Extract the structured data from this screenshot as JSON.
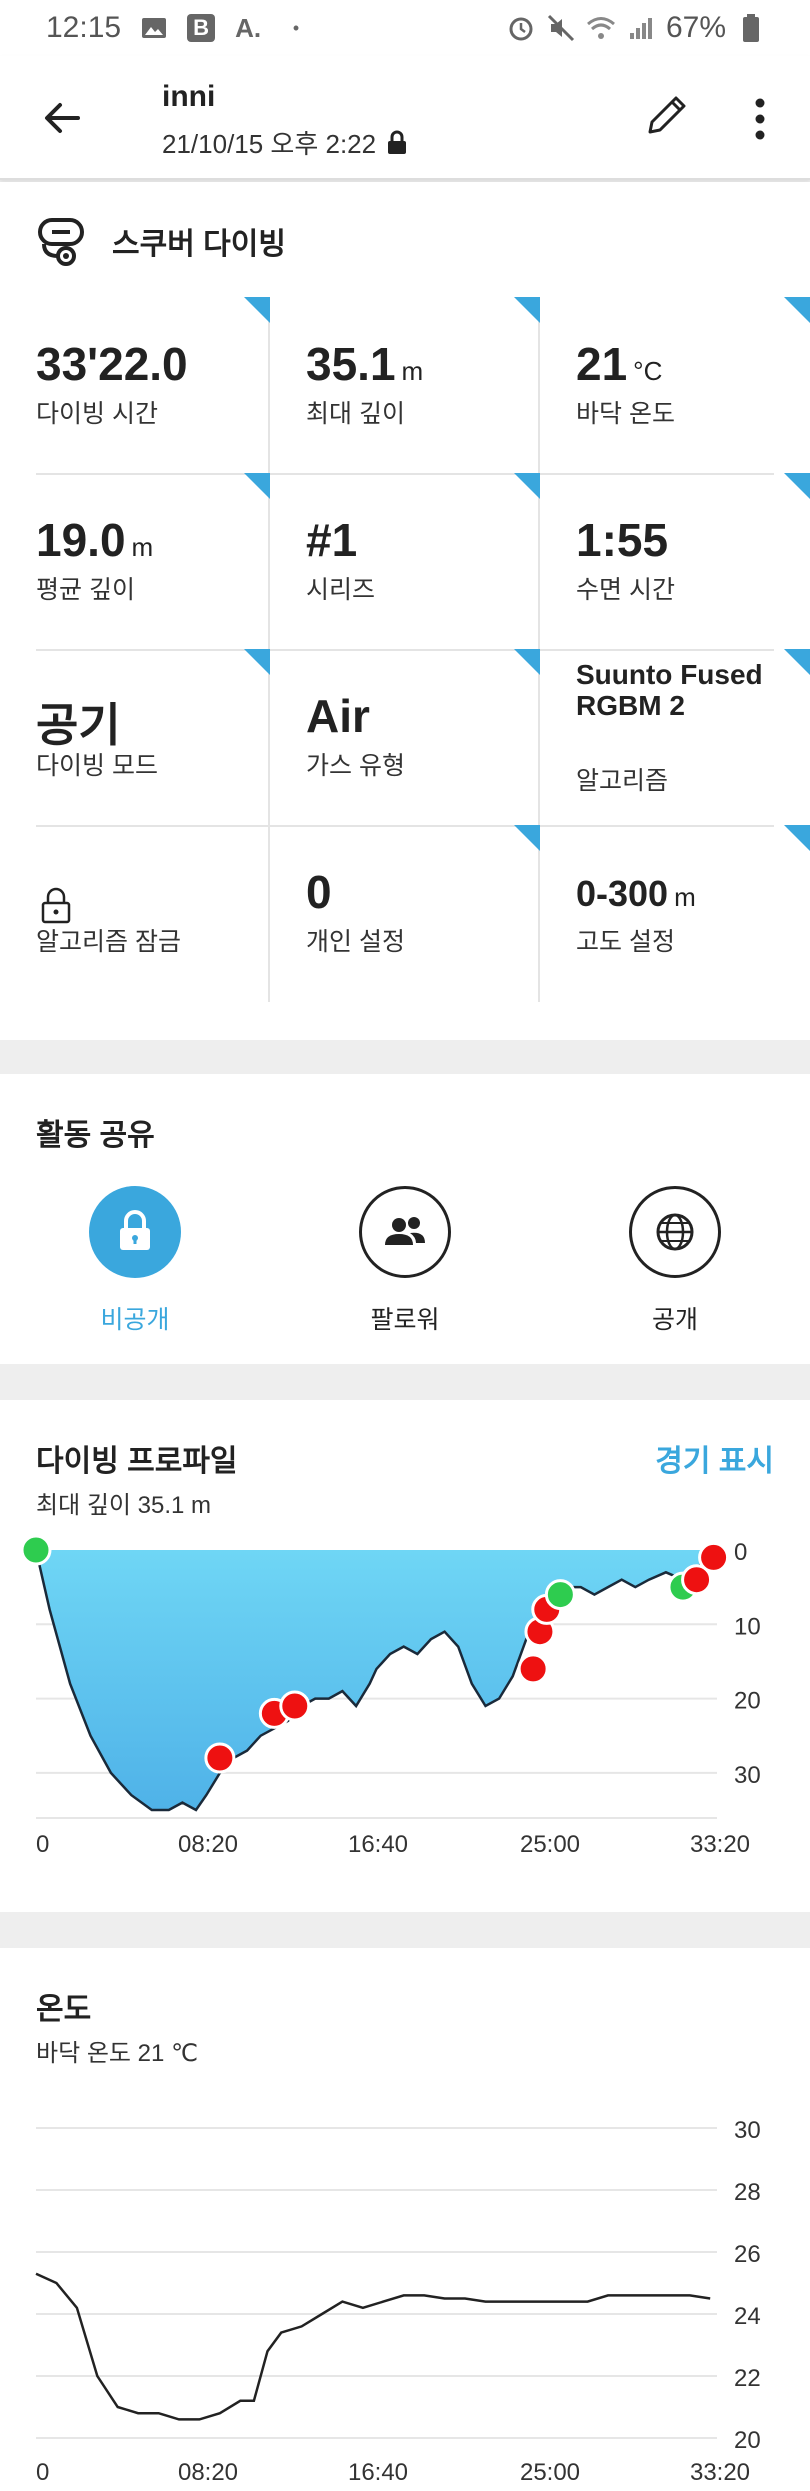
{
  "status_bar": {
    "time": "12:15",
    "left_icons": [
      "image-icon",
      "b-app-icon",
      "a-app-icon",
      "dot-icon"
    ],
    "battery": "67%",
    "right_icons": [
      "alarm-icon",
      "mute-icon",
      "wifi-icon",
      "signal-icon",
      "battery-icon"
    ]
  },
  "header": {
    "title": "inni",
    "subtitle": "21/10/15 오후 2:22"
  },
  "activity": {
    "name": "스쿠버 다이빙",
    "stats": [
      {
        "value": "33'22.0",
        "unit": "",
        "label": "다이빙 시간"
      },
      {
        "value": "35.1",
        "unit": "m",
        "label": "최대 깊이"
      },
      {
        "value": "21",
        "unit": "°C",
        "label": "바닥 온도"
      },
      {
        "value": "19.0",
        "unit": "m",
        "label": "평균 깊이"
      },
      {
        "value": "#1",
        "unit": "",
        "label": "시리즈"
      },
      {
        "value": "1:55",
        "unit": "",
        "label": "수면 시간"
      },
      {
        "value": "공기",
        "unit": "",
        "label": "다이빙 모드"
      },
      {
        "value": "Air",
        "unit": "",
        "label": "가스 유형"
      },
      {
        "value": "Suunto Fused RGBM 2",
        "unit": "",
        "label": "알고리즘"
      },
      {
        "value": "",
        "unit": "",
        "label": "알고리즘 잠금"
      },
      {
        "value": "0",
        "unit": "",
        "label": "개인 설정"
      },
      {
        "value": "0-300",
        "unit": "m",
        "label": "고도 설정"
      }
    ]
  },
  "share": {
    "title": "활동 공유",
    "options": [
      {
        "label": "비공개",
        "icon": "lock-icon",
        "selected": true
      },
      {
        "label": "팔로워",
        "icon": "followers-icon",
        "selected": false
      },
      {
        "label": "공개",
        "icon": "globe-icon",
        "selected": false
      }
    ],
    "accent": "#3aa7dd"
  },
  "profile": {
    "title": "다이빙 프로파일",
    "subtitle": "최대 깊이 35.1 m",
    "link": "경기 표시"
  },
  "temperature": {
    "title": "온도",
    "subtitle": "바닥 온도 21 ℃"
  },
  "chart_data": [
    {
      "type": "area",
      "x_ticks": [
        "0",
        "08:20",
        "16:40",
        "25:00",
        "33:20"
      ],
      "y_ticks": [
        "0",
        "10",
        "20",
        "30"
      ],
      "ylim": [
        35,
        0
      ],
      "xlim": [
        0,
        2000
      ],
      "fill_color": "#5ec8ee",
      "series": [
        {
          "x": [
            0,
            40,
            100,
            160,
            220,
            280,
            340,
            390,
            430,
            470,
            500,
            540,
            580,
            620,
            660,
            700,
            740,
            780,
            820,
            860,
            900,
            940,
            980,
            1000,
            1040,
            1080,
            1120,
            1160,
            1200,
            1240,
            1280,
            1320,
            1360,
            1400,
            1440,
            1480,
            1520,
            1560,
            1600,
            1640,
            1680,
            1720,
            1760,
            1800,
            1850,
            1900,
            1950,
            1990
          ],
          "y": [
            0,
            8,
            18,
            25,
            30,
            33,
            35,
            35,
            34,
            35,
            33,
            30,
            28,
            27,
            25,
            24,
            23,
            21,
            20,
            20,
            19,
            21,
            18,
            16,
            14,
            13,
            14,
            12,
            11,
            13,
            18,
            21,
            20,
            17,
            12,
            8,
            6,
            5,
            5,
            6,
            5,
            4,
            5,
            4,
            3,
            4,
            2,
            1
          ]
        }
      ],
      "markers": [
        {
          "x": 0,
          "y": 0,
          "color": "green"
        },
        {
          "x": 540,
          "y": 28,
          "color": "red"
        },
        {
          "x": 700,
          "y": 22,
          "color": "red"
        },
        {
          "x": 760,
          "y": 21,
          "color": "red"
        },
        {
          "x": 1460,
          "y": 16,
          "color": "red"
        },
        {
          "x": 1480,
          "y": 11,
          "color": "red"
        },
        {
          "x": 1500,
          "y": 8,
          "color": "red"
        },
        {
          "x": 1540,
          "y": 6,
          "color": "green"
        },
        {
          "x": 1900,
          "y": 5,
          "color": "green"
        },
        {
          "x": 1940,
          "y": 4,
          "color": "red"
        },
        {
          "x": 1990,
          "y": 1,
          "color": "red"
        }
      ]
    },
    {
      "type": "line",
      "x_ticks": [
        "0",
        "08:20",
        "16:40",
        "25:00",
        "33:20"
      ],
      "y_ticks": [
        "30",
        "28",
        "26",
        "24",
        "22",
        "20"
      ],
      "ylim": [
        20,
        30
      ],
      "xlim": [
        0,
        2000
      ],
      "series": [
        {
          "x": [
            0,
            60,
            120,
            180,
            240,
            300,
            360,
            420,
            480,
            540,
            600,
            640,
            680,
            720,
            780,
            840,
            900,
            960,
            1020,
            1080,
            1140,
            1200,
            1260,
            1320,
            1380,
            1440,
            1500,
            1560,
            1620,
            1680,
            1740,
            1800,
            1860,
            1920,
            1980
          ],
          "y": [
            25.3,
            25.0,
            24.2,
            22.0,
            21.0,
            20.8,
            20.8,
            20.6,
            20.6,
            20.8,
            21.2,
            21.2,
            22.8,
            23.4,
            23.6,
            24.0,
            24.4,
            24.2,
            24.4,
            24.6,
            24.6,
            24.5,
            24.5,
            24.4,
            24.4,
            24.4,
            24.4,
            24.4,
            24.4,
            24.6,
            24.6,
            24.6,
            24.6,
            24.6,
            24.5
          ]
        }
      ]
    }
  ]
}
